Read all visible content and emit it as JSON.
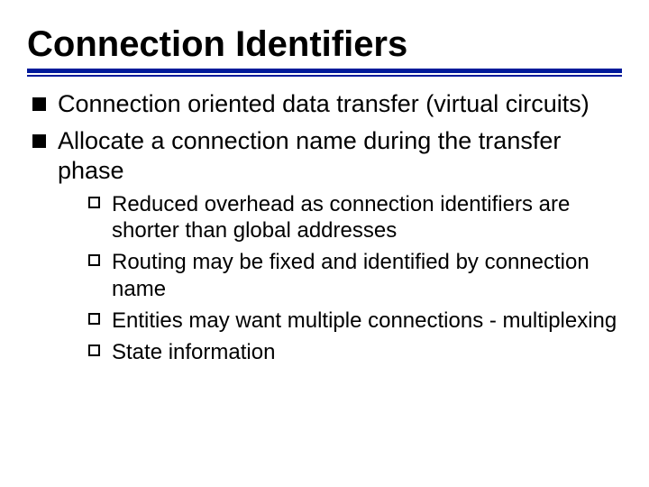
{
  "title": "Connection Identifiers",
  "bullets": {
    "b0": "Connection oriented data transfer (virtual circuits)",
    "b1": "Allocate a connection name during the transfer phase"
  },
  "subbullets": {
    "s0": "Reduced overhead as connection identifiers are shorter than global addresses",
    "s1": "Routing may be fixed and identified by connection name",
    "s2": "Entities may want multiple connections - multiplexing",
    "s3": "State information"
  }
}
